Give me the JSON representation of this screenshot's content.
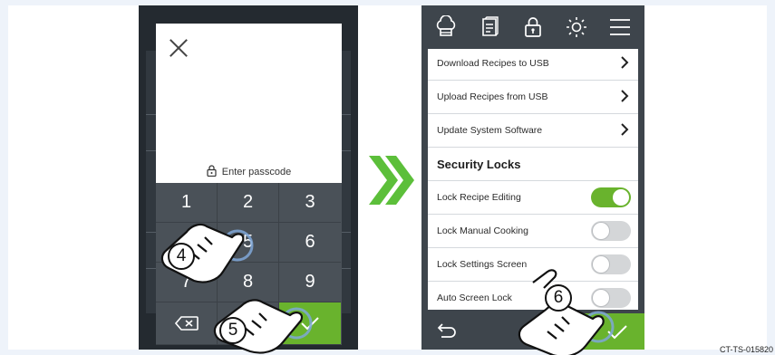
{
  "passcode_screen": {
    "close_icon": "close-icon",
    "prompt": "Enter passcode",
    "lock_icon": "lock-icon",
    "keys": [
      "1",
      "2",
      "3",
      "4",
      "5",
      "6",
      "7",
      "8",
      "9"
    ],
    "backspace_icon": "backspace-icon",
    "confirm_icon": "checkmark-icon"
  },
  "transition_icon": "double-chevron-right-icon",
  "settings_screen": {
    "toolbar_icons": [
      "chef-hat-icon",
      "recipe-book-icon",
      "lock-icon",
      "brightness-icon",
      "menu-icon"
    ],
    "rows": [
      {
        "label": "Download Recipes to USB",
        "kind": "link"
      },
      {
        "label": "Upload Recipes from USB",
        "kind": "link"
      },
      {
        "label": "Update System Software",
        "kind": "link"
      }
    ],
    "section_title": "Security Locks",
    "toggles": [
      {
        "label": "Lock Recipe Editing",
        "on": true
      },
      {
        "label": "Lock Manual Cooking",
        "on": false
      },
      {
        "label": "Lock Settings Screen",
        "on": false
      },
      {
        "label": "Auto Screen Lock",
        "on": false
      }
    ],
    "back_icon": "back-arrow-icon",
    "confirm_icon": "checkmark-icon"
  },
  "callouts": [
    "4",
    "5",
    "6"
  ],
  "colors": {
    "accent_green": "#69b32d",
    "keypad": "#4a5158",
    "screen_dark": "#3e454c"
  },
  "figure_code": "CT-TS-015820"
}
